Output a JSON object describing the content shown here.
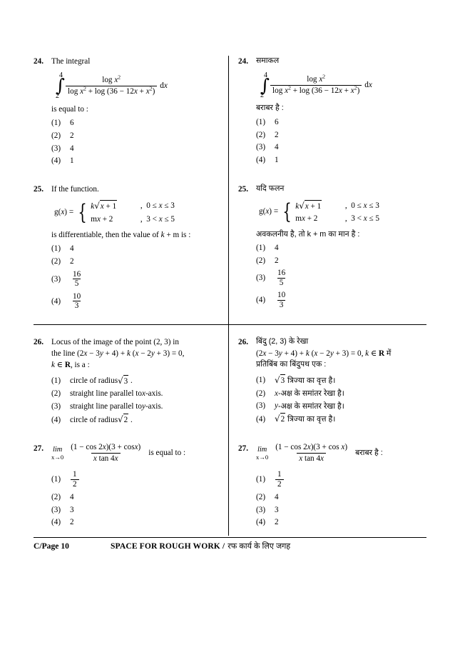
{
  "page": {
    "footer_page_label": "C/Page 10",
    "footer_rough_en": "SPACE FOR ROUGH WORK /",
    "footer_rough_hi": "रफ कार्य के लिए जगह"
  },
  "questions": [
    {
      "number": "24.",
      "en": {
        "stem": "The integral",
        "integral": {
          "upper": "4",
          "lower": "2",
          "numerator": "log x²",
          "denominator": "log x² + log (36 − 12x + x²)",
          "differential": "d x"
        },
        "lead": "is equal to :",
        "options": [
          "6",
          "2",
          "4",
          "1"
        ]
      },
      "hi": {
        "stem": "समाकल",
        "lead": "बराबर है :",
        "options": [
          "6",
          "2",
          "4",
          "1"
        ]
      }
    },
    {
      "number": "25.",
      "en": {
        "stem": "If the function.",
        "function_name": "g(x) =",
        "case1_expr": "k√x + 1",
        "case1_cond": "0 ≤ x ≤ 3",
        "case2_expr": "mx + 2",
        "case2_cond": "3 < x ≤ 5",
        "lead": "is differentiable, then the value of k + m is :",
        "options": [
          "4",
          "2",
          "16/5",
          "10/3"
        ]
      },
      "hi": {
        "stem": "यदि फलन",
        "lead": "अवकलनीय है, तो k + m का मान है :",
        "options": [
          "4",
          "2",
          "16/5",
          "10/3"
        ]
      }
    },
    {
      "number": "26.",
      "en": {
        "stem_line1": "Locus of the image of the point (2, 3) in",
        "stem_line2": "the line (2x − 3y + 4) + k (x − 2y + 3) = 0,",
        "stem_line3": "k ∈ R, is a :",
        "options": [
          "circle of radius √3 .",
          "straight line parallel to x-axis.",
          "straight line parallel to y-axis.",
          "circle of radius √2 ."
        ]
      },
      "hi": {
        "stem_line1": "बिंदु (2, 3) के रेखा",
        "stem_line2": "(2x − 3y + 4) + k (x − 2y + 3) = 0, k ∈ R में",
        "stem_line3": "प्रतिबिंब का बिंदुपथ एक :",
        "options": [
          "√3 त्रिज्या का वृत्त है।",
          "x-अक्ष के समांतर रेखा है।",
          "y-अक्ष के समांतर रेखा है।",
          "√2 त्रिज्या का वृत्त है।"
        ]
      }
    },
    {
      "number": "27.",
      "en": {
        "limit_var": "lim",
        "limit_to": "x→0",
        "numerator": "(1 − cos 2x)(3 + cos x)",
        "denominator": "x tan 4x",
        "lead": "is equal to :",
        "options": [
          "1/2",
          "4",
          "3",
          "2"
        ]
      },
      "hi": {
        "lead": "बराबर है :",
        "options": [
          "1/2",
          "4",
          "3",
          "2"
        ]
      }
    }
  ],
  "option_labels": [
    "(1)",
    "(2)",
    "(3)",
    "(4)"
  ]
}
